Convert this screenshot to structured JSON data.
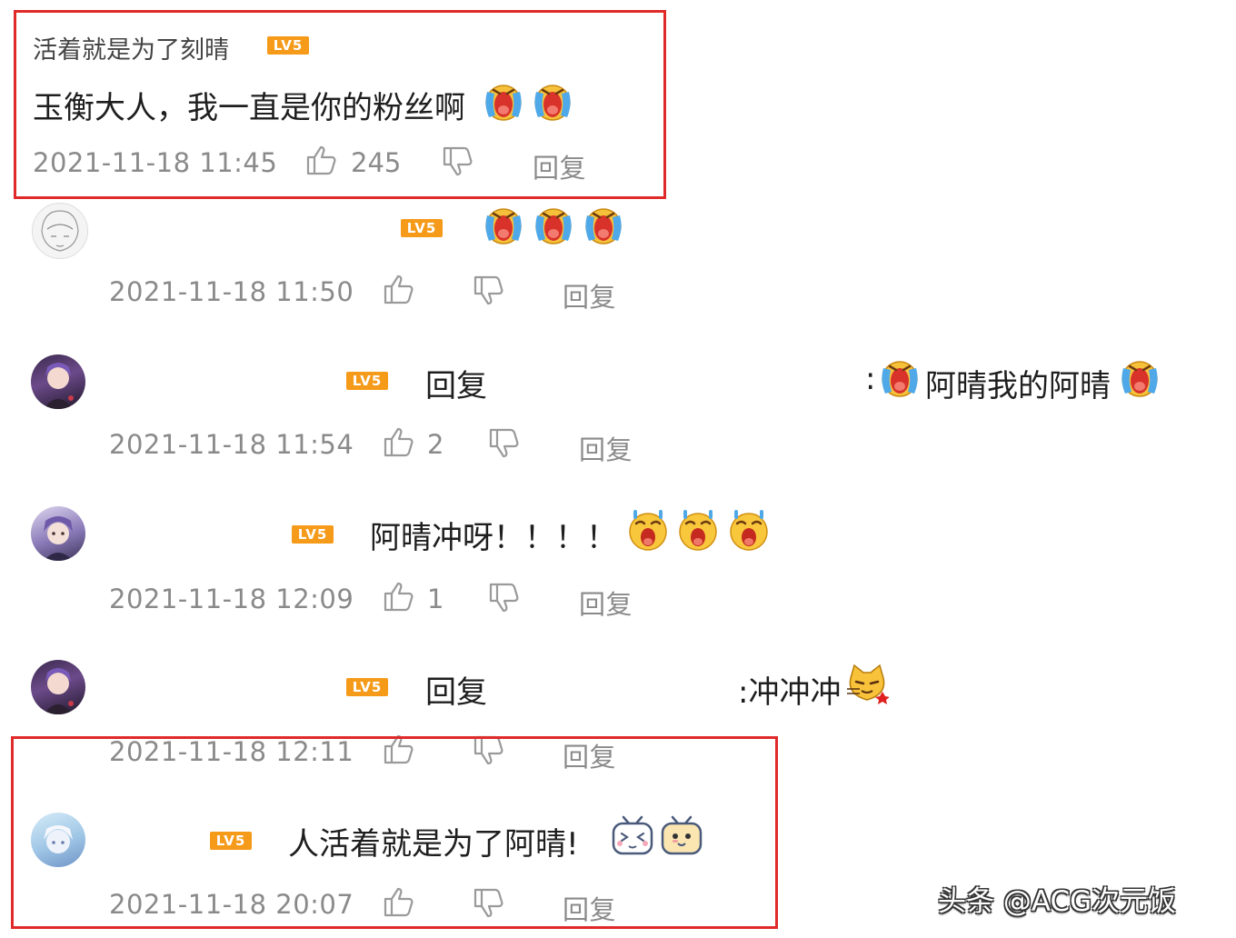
{
  "comments": [
    {
      "username": "活着就是为了刻晴",
      "level": "LV5",
      "text": "玉衡大人，我一直是你的粉丝啊",
      "time": "2021-11-18 11:45",
      "likes": "245",
      "reply_label": "回复"
    },
    {
      "level": "LV5",
      "time": "2021-11-18 11:50",
      "reply_label": "回复"
    },
    {
      "level": "LV5",
      "reply_prefix": "回复",
      "text_colon": ":",
      "text": "阿晴我的阿晴",
      "time": "2021-11-18 11:54",
      "likes": "2",
      "reply_label": "回复"
    },
    {
      "level": "LV5",
      "text": "阿晴冲呀！！！！",
      "time": "2021-11-18 12:09",
      "likes": "1",
      "reply_label": "回复"
    },
    {
      "level": "LV5",
      "reply_prefix": "回复",
      "text": ":冲冲冲",
      "time": "2021-11-18 12:11",
      "reply_label": "回复"
    },
    {
      "level": "LV5",
      "text": "人活着就是为了阿晴!",
      "time": "2021-11-18 20:07",
      "reply_label": "回复"
    }
  ],
  "watermark": "头条 @ACG次元饭",
  "colors": {
    "highlight_box": "#e02a2a",
    "level_badge": "#f59a19",
    "meta_text": "#8a8a8a"
  },
  "icons": [
    "thumb-up-icon",
    "thumb-down-icon",
    "crying-emoji",
    "shocked-emoji",
    "cat-emoji",
    "bilibili-tv-emoji"
  ]
}
